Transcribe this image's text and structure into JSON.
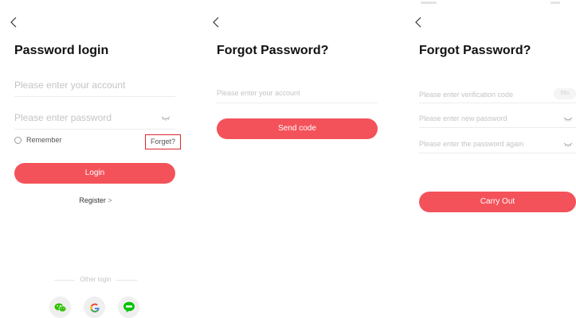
{
  "login": {
    "title": "Password login",
    "account_placeholder": "Please enter your account",
    "password_placeholder": "Please enter password",
    "remember_label": "Remember",
    "forget_label": "Forget?",
    "login_button": "Login",
    "register_label": "Register",
    "register_arrow": ">",
    "other_login": "Other login",
    "social": [
      "wechat-icon",
      "google-icon",
      "line-icon"
    ],
    "colors": {
      "accent": "#f4525a",
      "highlight_box": "#d9272e",
      "wechat": "#2dc100",
      "line": "#00c300"
    }
  },
  "forgot": {
    "title": "Forgot Password?",
    "account_placeholder": "Please enter your account",
    "send_button": "Send code"
  },
  "reset": {
    "title": "Forgot Password?",
    "code_placeholder": "Please enter verification code",
    "timer": "55s",
    "new_password_placeholder": "Please enter new password",
    "confirm_password_placeholder": "Please enter the password again",
    "carry_out_button": "Carry Out"
  }
}
